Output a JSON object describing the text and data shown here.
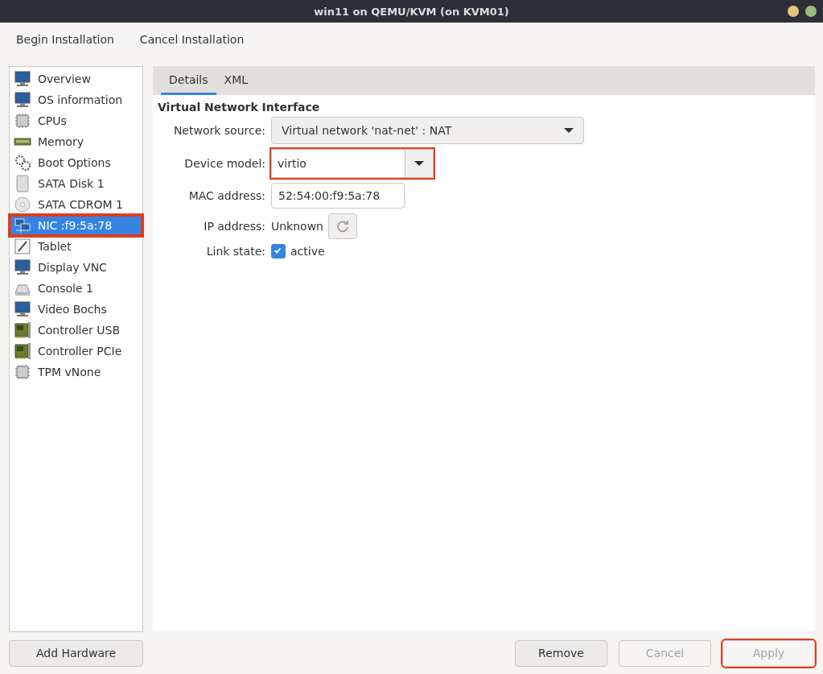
{
  "window": {
    "title": "win11 on QEMU/KVM (on KVM01)"
  },
  "toolbar": [
    {
      "label": "Begin Installation"
    },
    {
      "label": "Cancel Installation"
    }
  ],
  "sidebar": {
    "items": [
      {
        "label": "Overview",
        "kind": "display",
        "selected": false,
        "highlighted": false
      },
      {
        "label": "OS information",
        "kind": "display",
        "selected": false,
        "highlighted": false
      },
      {
        "label": "CPUs",
        "kind": "chip",
        "selected": false,
        "highlighted": false
      },
      {
        "label": "Memory",
        "kind": "memory",
        "selected": false,
        "highlighted": false
      },
      {
        "label": "Boot Options",
        "kind": "gears",
        "selected": false,
        "highlighted": false
      },
      {
        "label": "SATA Disk 1",
        "kind": "disk",
        "selected": false,
        "highlighted": false
      },
      {
        "label": "SATA CDROM 1",
        "kind": "cdrom",
        "selected": false,
        "highlighted": false
      },
      {
        "label": "NIC :f9:5a:78",
        "kind": "network",
        "selected": true,
        "highlighted": true
      },
      {
        "label": "Tablet",
        "kind": "tablet",
        "selected": false,
        "highlighted": false
      },
      {
        "label": "Display VNC",
        "kind": "display",
        "selected": false,
        "highlighted": false
      },
      {
        "label": "Console 1",
        "kind": "console",
        "selected": false,
        "highlighted": false
      },
      {
        "label": "Video Bochs",
        "kind": "display",
        "selected": false,
        "highlighted": false
      },
      {
        "label": "Controller USB",
        "kind": "card",
        "selected": false,
        "highlighted": false
      },
      {
        "label": "Controller PCIe",
        "kind": "card",
        "selected": false,
        "highlighted": false
      },
      {
        "label": "TPM vNone",
        "kind": "chip",
        "selected": false,
        "highlighted": false
      }
    ]
  },
  "tabs": [
    {
      "label": "Details",
      "selected": true
    },
    {
      "label": "XML",
      "selected": false
    }
  ],
  "section": {
    "title": "Virtual Network Interface"
  },
  "fields": [
    {
      "label": "Network source:",
      "kind": "dropdown",
      "value": "Virtual network 'nat-net' : NAT",
      "highlighted": false
    },
    {
      "label": "Device model:",
      "kind": "combo",
      "value": "virtio",
      "highlighted": true
    },
    {
      "label": "MAC address:",
      "kind": "entry",
      "value": "52:54:00:f9:5a:78",
      "highlighted": false
    },
    {
      "label": "IP address:",
      "kind": "readonly",
      "value": "Unknown"
    },
    {
      "label": "Link state:",
      "kind": "checkbox",
      "value": "active",
      "checked": true
    }
  ],
  "add_button": {
    "label": "Add Hardware"
  },
  "buttons": [
    {
      "label": "Remove",
      "disabled": false,
      "highlighted": false
    },
    {
      "label": "Cancel",
      "disabled": true,
      "highlighted": false
    },
    {
      "label": "Apply",
      "disabled": true,
      "highlighted": true
    }
  ]
}
